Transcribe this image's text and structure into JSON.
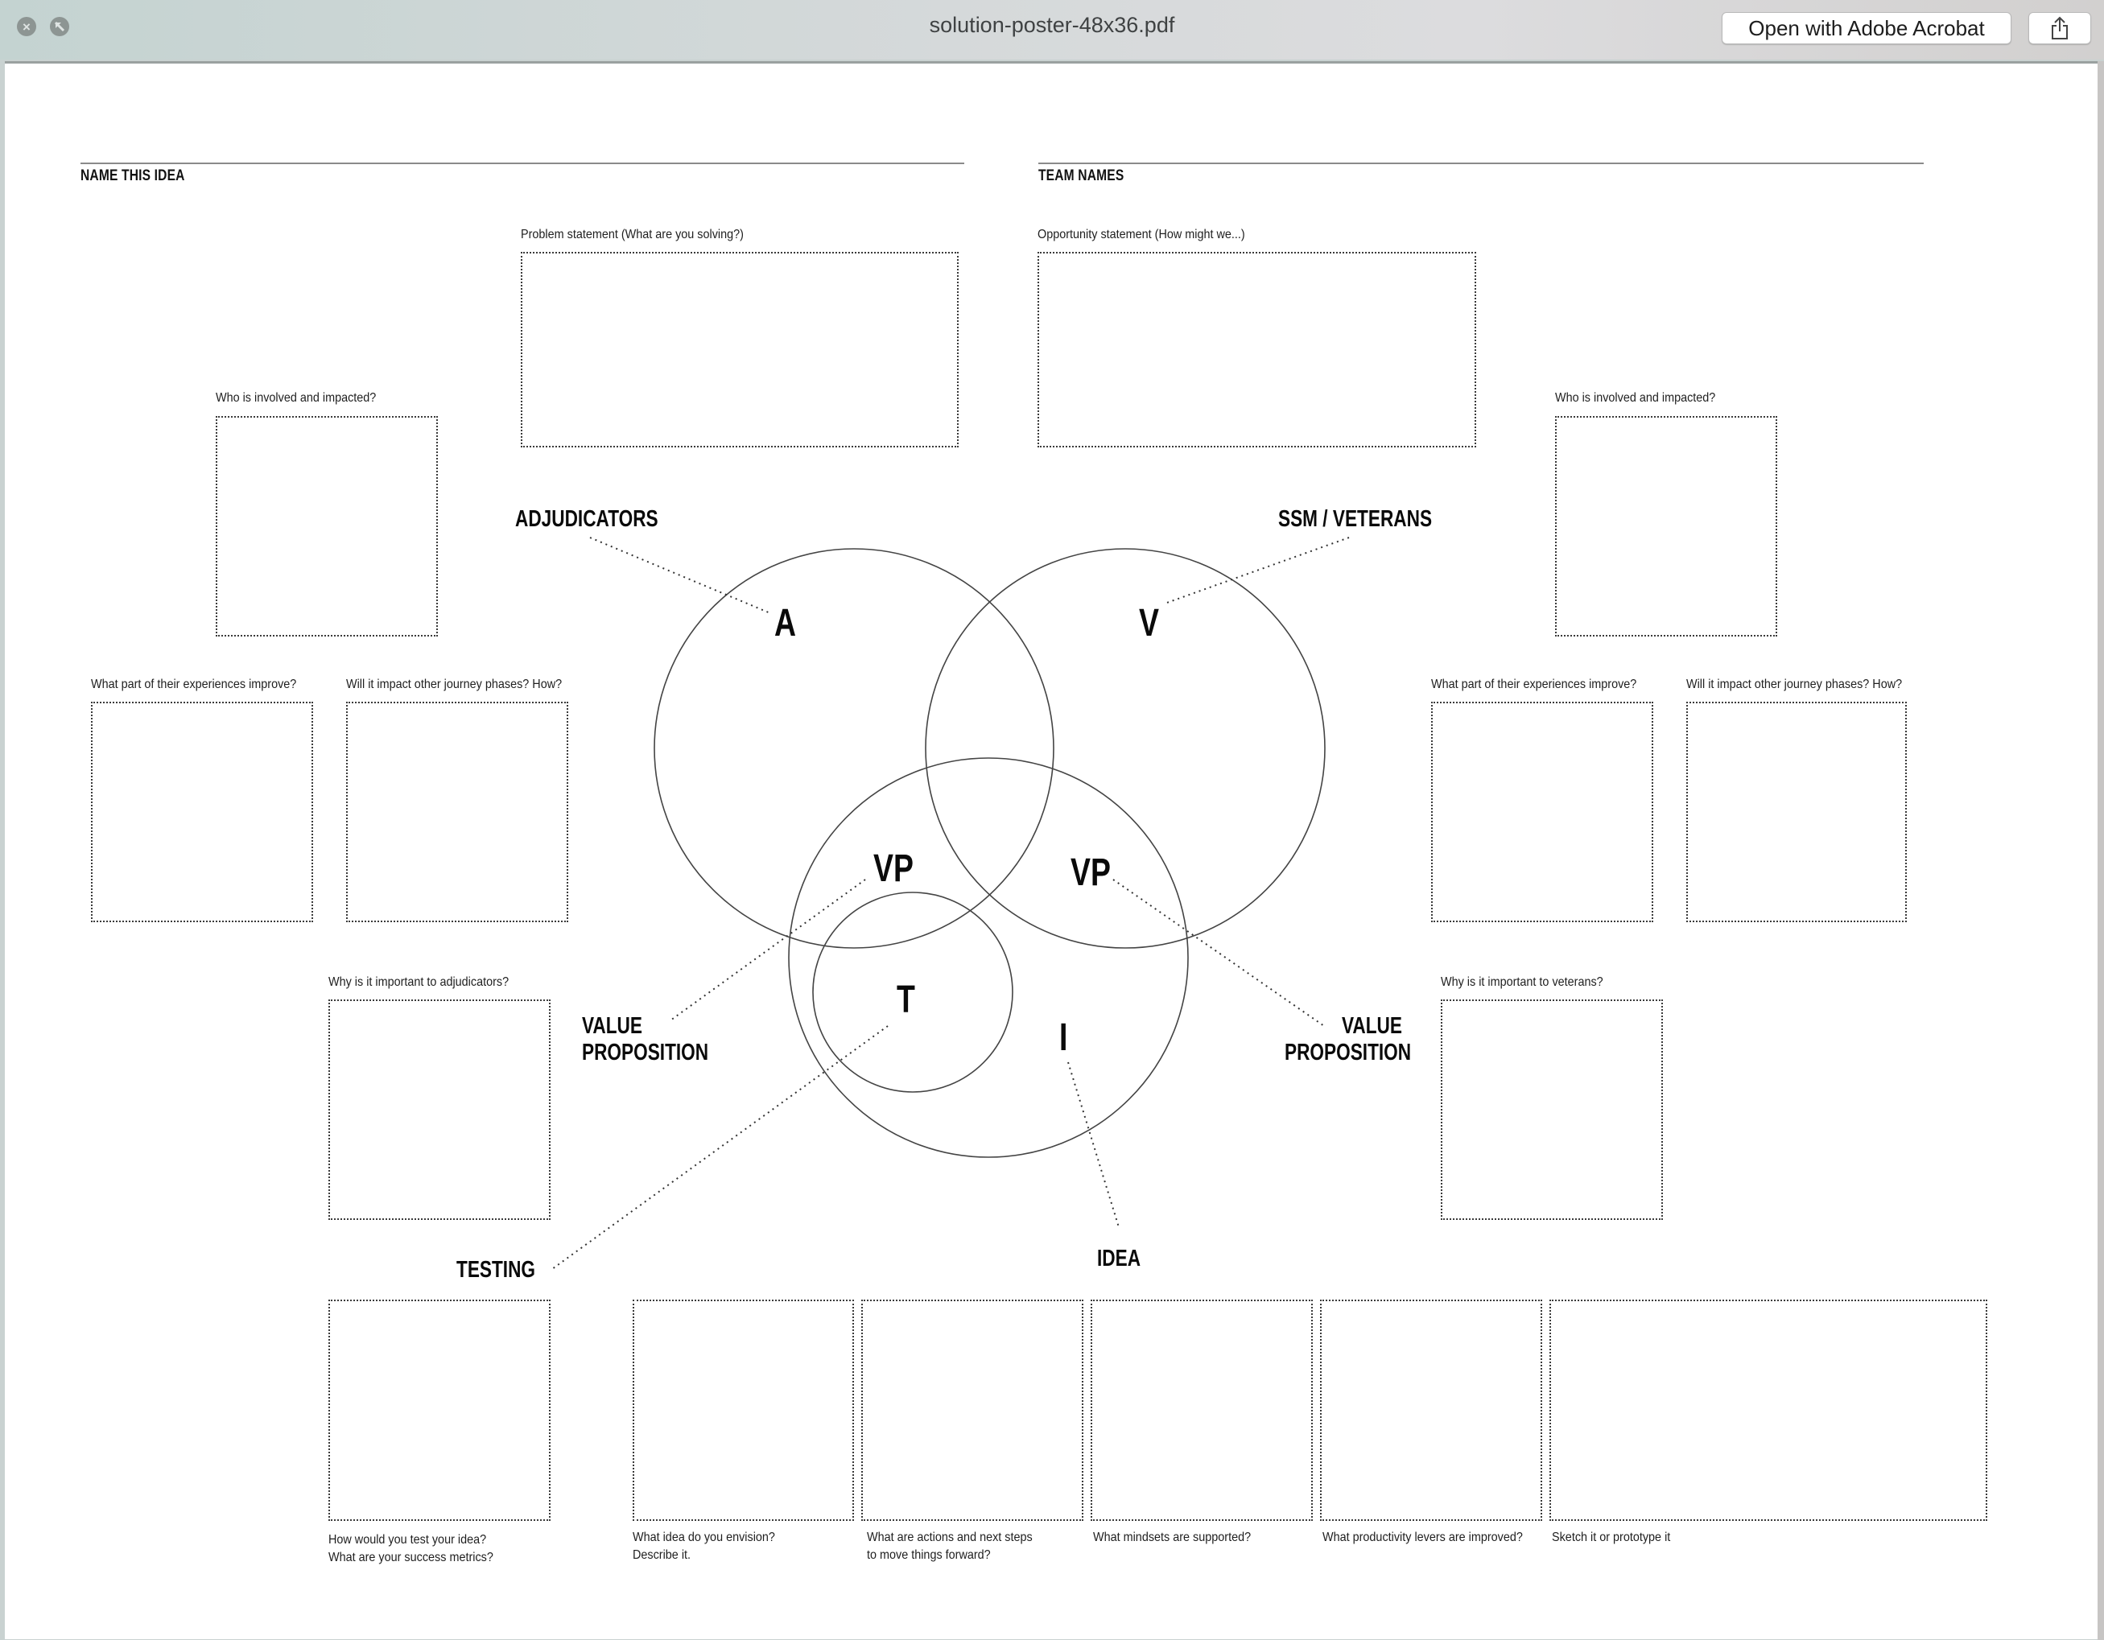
{
  "window": {
    "title": "solution-poster-48x36.pdf",
    "open_with_label": "Open with Adobe Acrobat",
    "close_icon": "close-icon",
    "fullscreen_icon": "fullscreen-icon",
    "share_icon": "share-icon"
  },
  "poster": {
    "name_this_idea": "NAME THIS IDEA",
    "team_names": "TEAM NAMES",
    "problem_statement": "Problem statement  (What are you solving?)",
    "opportunity_statement": "Opportunity statement (How might we...)",
    "left": {
      "who_involved": "Who is involved and impacted?",
      "experiences_improve": "What part of their experiences improve?",
      "journey_phases": "Will it impact other journey phases? How?",
      "why_important": "Why is it important to adjudicators?"
    },
    "right": {
      "who_involved": "Who is involved and impacted?",
      "experiences_improve": "What part of their experiences improve?",
      "journey_phases": "Will it impact other journey phases? How?",
      "why_important": "Why is it important to veterans?"
    },
    "venn": {
      "adjudicators_label": "ADJUDICATORS",
      "veterans_label": "SSM / VETERANS",
      "a_letter": "A",
      "v_letter": "V",
      "vp_left": "VP",
      "vp_right": "VP",
      "t_letter": "T",
      "i_letter": "I",
      "value_prop_left_1": "VALUE",
      "value_prop_left_2": "PROPOSITION",
      "value_prop_right_1": "VALUE",
      "value_prop_right_2": "PROPOSITION",
      "testing_label": "TESTING",
      "idea_label": "IDEA"
    },
    "bottom": {
      "testing_q1": "How would you test your idea?",
      "testing_q2": "What are your success metrics?",
      "envision_q1": "What idea do you envision?",
      "envision_q2": "Describe it.",
      "actions_q1": "What are actions and next steps",
      "actions_q2": "to move things forward?",
      "mindsets": "What mindsets are supported?",
      "productivity": "What productivity levers are improved?",
      "sketch": "Sketch it or prototype it"
    }
  }
}
